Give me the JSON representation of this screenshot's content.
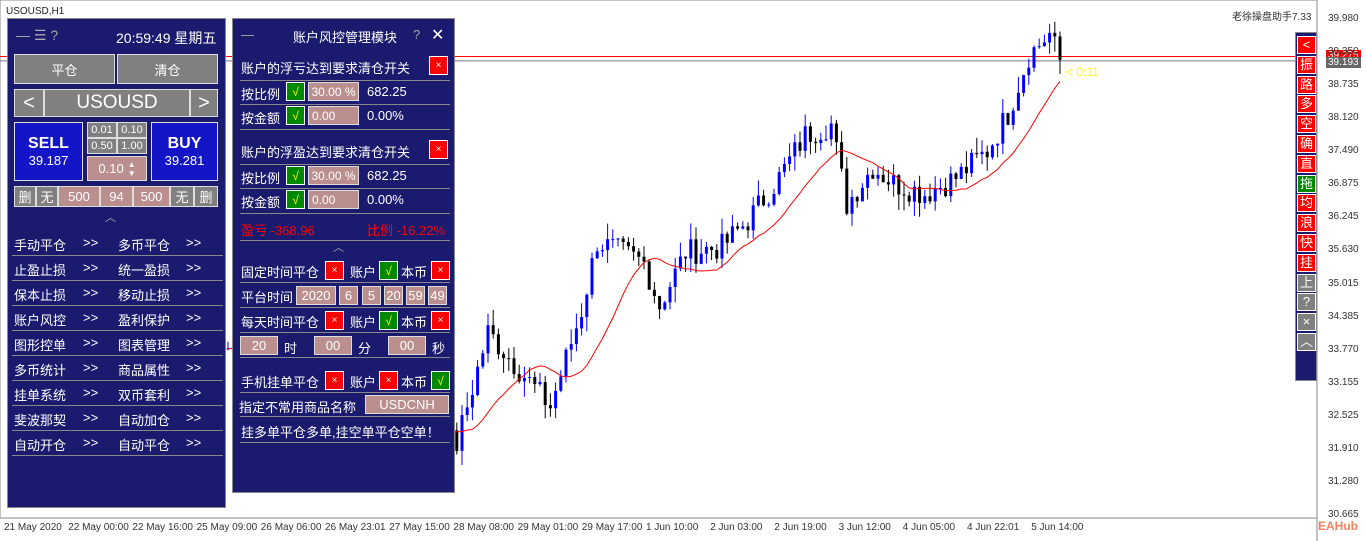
{
  "chart_header": {
    "symbol": "USOUSD,H1",
    "assistant": "老徐操盘助手7.33",
    "countdown": "< 0:11",
    "bid_label": "39.193",
    "ask_label": "39.275",
    "watermark": "EAHub"
  },
  "price_axis": [
    "39.980",
    "39.350",
    "38.735",
    "38.120",
    "37.490",
    "36.875",
    "36.245",
    "35.630",
    "35.015",
    "34.385",
    "33.770",
    "33.155",
    "32.525",
    "31.910",
    "31.280",
    "30.665"
  ],
  "time_axis": [
    "21 May 2020",
    "22 May 00:00",
    "22 May 16:00",
    "25 May 09:00",
    "26 May 06:00",
    "26 May 23:01",
    "27 May 15:00",
    "28 May 08:00",
    "29 May 01:00",
    "29 May 17:00",
    "1 Jun 10:00",
    "2 Jun 03:00",
    "2 Jun 19:00",
    "3 Jun 12:00",
    "4 Jun 05:00",
    "4 Jun 22:01",
    "5 Jun 14:00"
  ],
  "chart_data": {
    "type": "candlestick",
    "ylim": [
      30.665,
      39.98
    ],
    "anchors": [
      [
        0,
        33.8
      ],
      [
        44,
        32.0
      ],
      [
        50,
        34.1
      ],
      [
        56,
        33.4
      ],
      [
        62,
        32.7
      ],
      [
        68,
        34.5
      ],
      [
        71,
        35.8
      ],
      [
        80,
        35.4
      ],
      [
        83,
        34.6
      ],
      [
        88,
        35.6
      ],
      [
        95,
        35.7
      ],
      [
        100,
        36.2
      ],
      [
        106,
        37.0
      ],
      [
        111,
        37.8
      ],
      [
        116,
        38.0
      ],
      [
        119,
        36.5
      ],
      [
        124,
        37.2
      ],
      [
        128,
        36.9
      ],
      [
        134,
        36.7
      ],
      [
        140,
        37.0
      ],
      [
        146,
        37.5
      ],
      [
        150,
        38.2
      ],
      [
        154,
        39.3
      ],
      [
        158,
        39.7
      ],
      [
        160,
        39.2
      ]
    ],
    "colors": {
      "up": "#0000ff",
      "down": "#000000",
      "ma": "#ff0000"
    }
  },
  "left": {
    "time": "20:59:49",
    "weekday": "星期五",
    "close_btn": "平仓",
    "clear_btn": "清仓",
    "symbol": "USOUSD",
    "prev": "<",
    "next": ">",
    "sell": "SELL",
    "sell_price": "39.187",
    "buy": "BUY",
    "buy_price": "39.281",
    "lots": [
      "0.01",
      "0.10",
      "0.50",
      "1.00"
    ],
    "lot": "0.10",
    "row": [
      "删",
      "无",
      "500",
      "94",
      "500",
      "无",
      "删"
    ],
    "menu": [
      [
        "手动平仓",
        ">>",
        "多币平仓",
        ">>"
      ],
      [
        "止盈止损",
        ">>",
        "统一盈损",
        ">>"
      ],
      [
        "保本止损",
        ">>",
        "移动止损",
        ">>"
      ],
      [
        "账户风控",
        ">>",
        "盈利保护",
        ">>"
      ],
      [
        "图形控单",
        ">>",
        "图表管理",
        ">>"
      ],
      [
        "多币统计",
        ">>",
        "商品属性",
        ">>"
      ],
      [
        "挂单系统",
        ">>",
        "双币套利",
        ">>"
      ],
      [
        "斐波那契",
        ">>",
        "自动加仓",
        ">>"
      ],
      [
        "自动开仓",
        ">>",
        "自动平仓",
        ">>"
      ]
    ]
  },
  "risk": {
    "title": "账户风控管理模块",
    "help": "?",
    "close": "✕",
    "loss_switch": "账户的浮亏达到要求清仓开关",
    "profit_switch": "账户的浮盈达到要求清仓开关",
    "by_ratio": "按比例",
    "by_amount": "按金额",
    "ratio_val": "30.00 %",
    "ratio_amt": "682.25",
    "amt_val": "0.00",
    "amt_pct": "0.00%",
    "pl": "盈亏 -368.96",
    "pl_ratio": "比例 -16.22%",
    "fixed_close": "固定时间平仓",
    "account": "账户",
    "own_coin": "本币",
    "platform_time": "平台时间",
    "pt": [
      "2020",
      "6",
      "5",
      "20",
      "59",
      "49"
    ],
    "daily_close": "每天时间平仓",
    "hh": "20",
    "h": "时",
    "mm": "00",
    "m": "分",
    "ss": "00",
    "s": "秒",
    "mobile_close": "手机挂单平仓",
    "rare_symbol": "指定不常用商品名称",
    "rare_val": "USDCNH",
    "note": "挂多单平仓多单,挂空单平仓空单！",
    "x": "×",
    "v": "√"
  },
  "side": [
    "<",
    "振",
    "路",
    "多",
    "空",
    "确",
    "直",
    "拖",
    "均",
    "浪",
    "快",
    "挂",
    "上",
    "?",
    "×",
    "︿"
  ]
}
